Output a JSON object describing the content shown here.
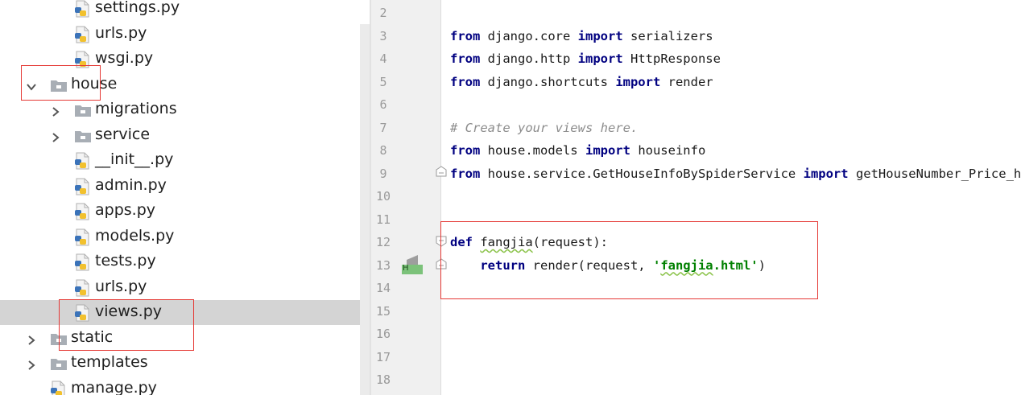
{
  "tree": {
    "items": [
      {
        "label": "settings.py",
        "kind": "python",
        "depth": 2,
        "expandable": false,
        "expanded": false,
        "selected": false
      },
      {
        "label": "urls.py",
        "kind": "python",
        "depth": 2,
        "expandable": false,
        "expanded": false,
        "selected": false
      },
      {
        "label": "wsgi.py",
        "kind": "python",
        "depth": 2,
        "expandable": false,
        "expanded": false,
        "selected": false
      },
      {
        "label": "house",
        "kind": "folder",
        "depth": 1,
        "expandable": true,
        "expanded": true,
        "selected": false
      },
      {
        "label": "migrations",
        "kind": "folder",
        "depth": 2,
        "expandable": true,
        "expanded": false,
        "selected": false
      },
      {
        "label": "service",
        "kind": "folder",
        "depth": 2,
        "expandable": true,
        "expanded": false,
        "selected": false
      },
      {
        "label": "__init__.py",
        "kind": "python",
        "depth": 2,
        "expandable": false,
        "expanded": false,
        "selected": false
      },
      {
        "label": "admin.py",
        "kind": "python",
        "depth": 2,
        "expandable": false,
        "expanded": false,
        "selected": false
      },
      {
        "label": "apps.py",
        "kind": "python",
        "depth": 2,
        "expandable": false,
        "expanded": false,
        "selected": false
      },
      {
        "label": "models.py",
        "kind": "python",
        "depth": 2,
        "expandable": false,
        "expanded": false,
        "selected": false
      },
      {
        "label": "tests.py",
        "kind": "python",
        "depth": 2,
        "expandable": false,
        "expanded": false,
        "selected": false
      },
      {
        "label": "urls.py",
        "kind": "python",
        "depth": 2,
        "expandable": false,
        "expanded": false,
        "selected": false
      },
      {
        "label": "views.py",
        "kind": "python",
        "depth": 2,
        "expandable": false,
        "expanded": false,
        "selected": true
      },
      {
        "label": "static",
        "kind": "folder",
        "depth": 1,
        "expandable": true,
        "expanded": false,
        "selected": false
      },
      {
        "label": "templates",
        "kind": "folder",
        "depth": 1,
        "expandable": true,
        "expanded": false,
        "selected": false
      },
      {
        "label": "manage.py",
        "kind": "python",
        "depth": 1,
        "expandable": false,
        "expanded": false,
        "selected": false
      }
    ]
  },
  "editor": {
    "line_numbers": [
      "2",
      "3",
      "4",
      "5",
      "6",
      "7",
      "8",
      "9",
      "10",
      "11",
      "12",
      "13",
      "14",
      "15",
      "16",
      "17",
      "18"
    ],
    "lines": [
      [],
      [
        {
          "t": "kw",
          "v": "from"
        },
        {
          "t": "tx",
          "v": " django.core "
        },
        {
          "t": "kw",
          "v": "import"
        },
        {
          "t": "tx",
          "v": " serializers"
        }
      ],
      [
        {
          "t": "kw",
          "v": "from"
        },
        {
          "t": "tx",
          "v": " django.http "
        },
        {
          "t": "kw",
          "v": "import"
        },
        {
          "t": "tx",
          "v": " HttpResponse"
        }
      ],
      [
        {
          "t": "kw",
          "v": "from"
        },
        {
          "t": "tx",
          "v": " django.shortcuts "
        },
        {
          "t": "kw",
          "v": "import"
        },
        {
          "t": "tx",
          "v": " render"
        }
      ],
      [],
      [
        {
          "t": "cm",
          "v": "# Create your views here."
        }
      ],
      [
        {
          "t": "kw",
          "v": "from"
        },
        {
          "t": "tx",
          "v": " house.models "
        },
        {
          "t": "kw",
          "v": "import"
        },
        {
          "t": "tx",
          "v": " houseinfo"
        }
      ],
      [
        {
          "t": "kw",
          "v": "from"
        },
        {
          "t": "tx",
          "v": " house.service.GetHouseInfoBySpiderService "
        },
        {
          "t": "kw",
          "v": "import"
        },
        {
          "t": "tx",
          "v": " getHouseNumber_Price_hot"
        }
      ],
      [],
      [],
      [
        {
          "t": "kw",
          "v": "def"
        },
        {
          "t": "tx",
          "v": " "
        },
        {
          "t": "wv",
          "v": "fangjia"
        },
        {
          "t": "tx",
          "v": "(request):"
        }
      ],
      [
        {
          "t": "tx",
          "v": "    "
        },
        {
          "t": "kw",
          "v": "return"
        },
        {
          "t": "tx",
          "v": " render(request, "
        },
        {
          "t": "st",
          "v": "'"
        },
        {
          "t": "stw",
          "v": "fangjia"
        },
        {
          "t": "st",
          "v": ".html'"
        },
        {
          "t": "tx",
          "v": ")"
        }
      ],
      [],
      [],
      [],
      [],
      []
    ],
    "gutter_marker_label": "H"
  },
  "colors": {
    "keyword": "#000080",
    "comment": "#8c8c8c",
    "string": "#008000",
    "annotation": "#e53935",
    "selection": "#d4d4d4",
    "marker": "#7cc27a"
  }
}
